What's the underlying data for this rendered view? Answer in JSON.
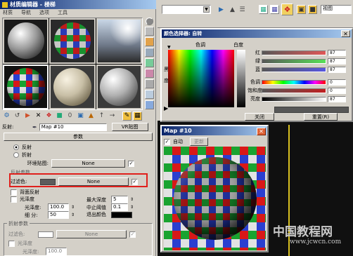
{
  "mat_editor": {
    "title": "材质编辑器 - 楼梯",
    "menus": [
      "材质",
      "导航",
      "选项",
      "工具"
    ],
    "map_label": "反射:",
    "map_name": "Map #10",
    "map_type": "VR贴图",
    "params_header": "参数",
    "radio_reflect": "反射",
    "radio_refract": "折射",
    "env_map_label": "环境贴图:",
    "none": "None",
    "reflect_params_label": "反射参数",
    "filter_label": "过滤色:",
    "backface_label": "背面反射",
    "glossy_label": "光泽度",
    "gloss_amount_label": "光泽度:",
    "gloss_amount": "100.0",
    "subdiv_label": "细  分:",
    "subdiv": "50",
    "max_depth_label": "最大深度",
    "max_depth": "5",
    "cutoff_label": "中止阈值",
    "cutoff": "0.1",
    "exit_color_label": "退出颜色",
    "refract_params_label": "折射参数",
    "filter2_label": "过滤色:",
    "glossy2_label": "光泽度",
    "gloss2_label": "光泽度:",
    "gloss2_value": "100.0"
  },
  "right_toolbar": {
    "view_label": "视图"
  },
  "color_selector": {
    "title": "颜色选择器: 自转",
    "hue_label": "色调",
    "white_label": "白度",
    "black_label": "黑",
    "degree_label": "度",
    "red": "红",
    "green": "绿",
    "blue": "蓝",
    "hue2": "色调",
    "sat": "饱和度",
    "val": "亮度",
    "red_val": "87",
    "green_val": "87",
    "blue_val": "87",
    "hue_val": "0",
    "sat_val": "0",
    "val_val": "87",
    "close_btn": "关闭",
    "reset_btn": "重置(R)"
  },
  "map_window": {
    "title": "Map #10",
    "auto_label": "自动",
    "update_label": "更新"
  },
  "watermark": {
    "cn": "中国教程网",
    "url": "www.jcwcn.com"
  },
  "colors": {
    "highlight_box": "#e0201c",
    "title_blue": "#0a246a"
  }
}
